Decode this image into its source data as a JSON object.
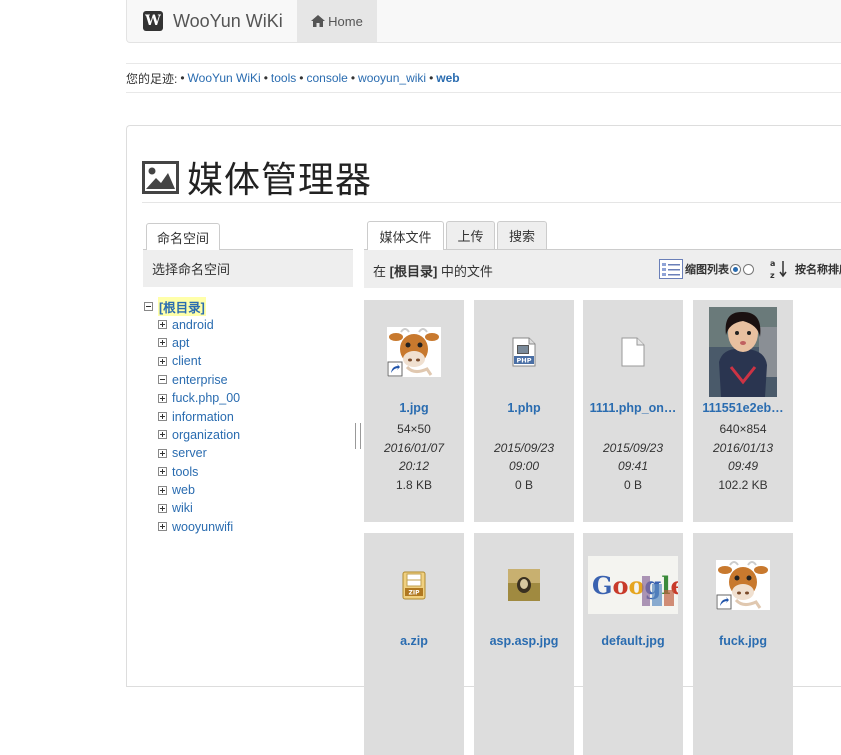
{
  "navbar": {
    "brand_logo": "W",
    "brand": "WooYun WiKi",
    "home_label": "Home"
  },
  "breadcrumbs": {
    "prefix": "您的足迹:",
    "items": [
      "WooYun WiKi",
      "tools",
      "console",
      "wooyun_wiki",
      "web"
    ],
    "separator": "•"
  },
  "page": {
    "title": "媒体管理器"
  },
  "namespace_panel": {
    "tab": "命名空间",
    "header": "选择命名空间",
    "root": "[根目录]",
    "items": [
      {
        "label": "android",
        "state": "collapsed"
      },
      {
        "label": "apt",
        "state": "collapsed"
      },
      {
        "label": "client",
        "state": "collapsed"
      },
      {
        "label": "enterprise",
        "state": "expanded"
      },
      {
        "label": "fuck.php_00",
        "state": "collapsed"
      },
      {
        "label": "information",
        "state": "collapsed"
      },
      {
        "label": "organization",
        "state": "collapsed"
      },
      {
        "label": "server",
        "state": "collapsed"
      },
      {
        "label": "tools",
        "state": "collapsed"
      },
      {
        "label": "web",
        "state": "collapsed"
      },
      {
        "label": "wiki",
        "state": "collapsed"
      },
      {
        "label": "wooyunwifi",
        "state": "collapsed"
      }
    ]
  },
  "file_panel": {
    "tabs": [
      "媒体文件",
      "上传",
      "搜索"
    ],
    "active_tab": "媒体文件",
    "header_prefix": "在 ",
    "header_ns": "[根目录]",
    "header_suffix": " 中的文件",
    "view_label": "缩图列表",
    "sort_label": "按名称排序",
    "view_mode": "thumbnails"
  },
  "files": [
    {
      "name": "1.jpg",
      "dims": "54×50",
      "date": "2016/01/07",
      "time": "20:12",
      "size": "1.8 KB",
      "thumb": "cow-shortcut-icon"
    },
    {
      "name": "1.php",
      "dims": "",
      "date": "2015/09/23",
      "time": "09:00",
      "size": "0 B",
      "thumb": "php-file-icon"
    },
    {
      "name": "1111.php_on…",
      "dims": "",
      "date": "2015/09/23",
      "time": "09:41",
      "size": "0 B",
      "thumb": "blank-file-icon"
    },
    {
      "name": "111551e2eb…",
      "dims": "640×854",
      "date": "2016/01/13",
      "time": "09:49",
      "size": "102.2 KB",
      "thumb": "portrait-photo"
    },
    {
      "name": "a.zip",
      "thumb": "zip-file-icon"
    },
    {
      "name": "asp.asp.jpg",
      "thumb": "small-photo"
    },
    {
      "name": "default.jpg",
      "thumb": "google-logo-image"
    },
    {
      "name": "fuck.jpg",
      "thumb": "cow-shortcut-icon"
    }
  ],
  "colors": {
    "link": "#2a6cb0",
    "card_bg": "#dddddd",
    "nav_bg": "#f8f8f8",
    "highlight": "#ffffaa"
  }
}
